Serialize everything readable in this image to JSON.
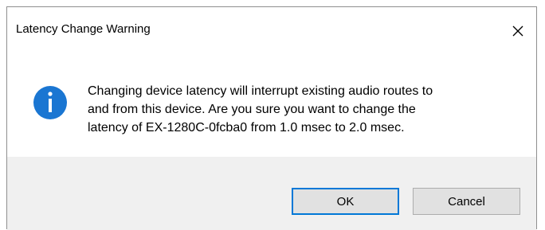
{
  "dialog": {
    "title": "Latency Change Warning",
    "close_icon": "close-icon",
    "message_icon": "info-icon",
    "message_lines": [
      "Changing device latency will interrupt existing audio routes to",
      "and from this device. Are you sure you want to change the",
      "latency of EX-1280C-0fcba0 from 1.0 msec to 2.0 msec."
    ],
    "buttons": {
      "ok_label": "OK",
      "cancel_label": "Cancel"
    },
    "colors": {
      "info_icon": "#1a76d2",
      "default_button_border": "#0078d7",
      "footer_background": "#f0f0f0"
    }
  }
}
